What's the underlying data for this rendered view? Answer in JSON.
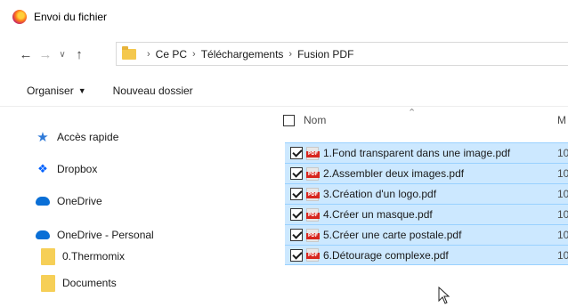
{
  "window": {
    "title": "Envoi du fichier",
    "icon": "firefox-icon"
  },
  "address": {
    "crumbs": [
      "Ce PC",
      "Téléchargements",
      "Fusion PDF"
    ],
    "icons": [
      "back-arrow-icon",
      "forward-arrow-icon",
      "chevron-down-icon",
      "up-arrow-icon",
      "folder-icon"
    ]
  },
  "toolbar": {
    "organize_label": "Organiser",
    "new_folder_label": "Nouveau dossier"
  },
  "sidebar": {
    "items": [
      {
        "label": "Accès rapide",
        "icon": "star-icon"
      },
      {
        "label": "Dropbox",
        "icon": "dropbox-icon"
      },
      {
        "label": "OneDrive",
        "icon": "cloud-icon"
      },
      {
        "label": "OneDrive - Personal",
        "icon": "cloud-icon"
      },
      {
        "label": "0.Thermomix",
        "icon": "folder-icon"
      },
      {
        "label": "Documents",
        "icon": "folder-icon"
      }
    ]
  },
  "file_list": {
    "header": {
      "name": "Nom",
      "second_col": "M"
    },
    "files": [
      {
        "name": "1.Fond transparent dans une image.pdf",
        "col2": "10"
      },
      {
        "name": "2.Assembler deux images.pdf",
        "col2": "10"
      },
      {
        "name": "3.Création d'un logo.pdf",
        "col2": "10"
      },
      {
        "name": "4.Créer un masque.pdf",
        "col2": "10"
      },
      {
        "name": "5.Créer une carte postale.pdf",
        "col2": "10"
      },
      {
        "name": "6.Détourage complexe.pdf",
        "col2": "10"
      }
    ]
  },
  "colors": {
    "selection_bg": "#cce8ff",
    "selection_border": "#99d1ff",
    "pdf_red": "#d7261e",
    "folder_yellow": "#f6cf57"
  }
}
